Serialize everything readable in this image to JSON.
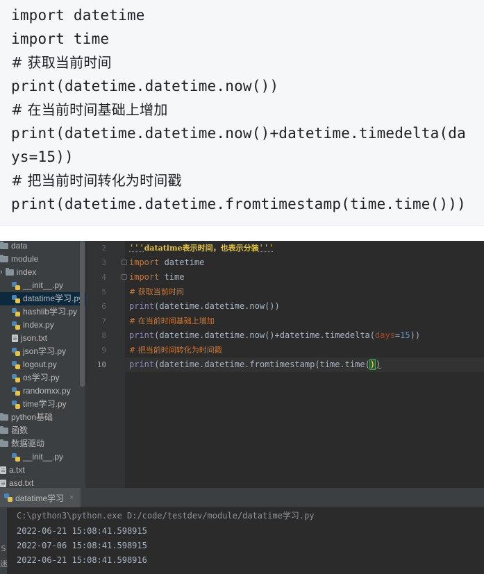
{
  "code_block": {
    "lines": [
      "import datetime",
      "import time",
      "# 获取当前时间",
      "print(datetime.datetime.now())",
      "# 在当前时间基础上增加",
      "print(datetime.datetime.now()+datetime.timedelta(da",
      "ys=15))",
      "# 把当前时间转化为时间戳",
      "print(datetime.datetime.fromtimestamp(time.time()))"
    ]
  },
  "ide": {
    "project_tree": [
      {
        "label": "data",
        "type": "folder"
      },
      {
        "label": "module",
        "type": "folder"
      },
      {
        "label": "index",
        "type": "folder",
        "expander": "›"
      },
      {
        "label": "__init__.py",
        "type": "py"
      },
      {
        "label": "datatime学习.py",
        "type": "py",
        "selected": true
      },
      {
        "label": "hashlib学习.py",
        "type": "py"
      },
      {
        "label": "index.py",
        "type": "py"
      },
      {
        "label": "json.txt",
        "type": "txt"
      },
      {
        "label": "json学习.py",
        "type": "py"
      },
      {
        "label": "logout.py",
        "type": "py"
      },
      {
        "label": "os学习.py",
        "type": "py"
      },
      {
        "label": "randomxx.py",
        "type": "py"
      },
      {
        "label": "time学习.py",
        "type": "py"
      },
      {
        "label": "python基础",
        "type": "folder"
      },
      {
        "label": "函数",
        "type": "folder"
      },
      {
        "label": "数据驱动",
        "type": "folder"
      },
      {
        "label": "__init__.py",
        "type": "py"
      },
      {
        "label": "a.txt",
        "type": "txt"
      },
      {
        "label": "asd.txt",
        "type": "txt"
      }
    ],
    "line_numbers": [
      "2",
      "3",
      "4",
      "5",
      "6",
      "7",
      "8",
      "9",
      "10"
    ],
    "editor": {
      "docstring_quote": "'''",
      "docstring_text": "datatime表示时间，也表示分装",
      "import_kw": "import",
      "mod_datetime": " datetime",
      "mod_time": " time",
      "comment_1": "# 获取当前时间",
      "comment_2": "# 在当前时间基础上增加",
      "comment_3": "# 把当前时间转化为时间戳",
      "print_fn": "print",
      "line6_rest": "(datetime.datetime.now())",
      "line8_a": "(datetime.datetime.now()+datetime.timedelta(",
      "line8_param": "days",
      "line8_eq": "=",
      "line8_num": "15",
      "line8_close": "))",
      "line10_a": "(datetime.datetime.fromtimestamp(time.time(",
      "line10_hl": ")",
      "line10_close": ")"
    },
    "run": {
      "tab_label": "datatime学习",
      "close": "×",
      "command": "C:\\python3\\python.exe D:/code/testdev/module/datatime学习.py",
      "output": [
        "2022-06-21 15:08:41.598915",
        "2022-07-06 15:08:41.598915",
        "2022-06-21 15:08:41.598916"
      ],
      "side_glyphs": [
        "S",
        "迷"
      ]
    }
  }
}
